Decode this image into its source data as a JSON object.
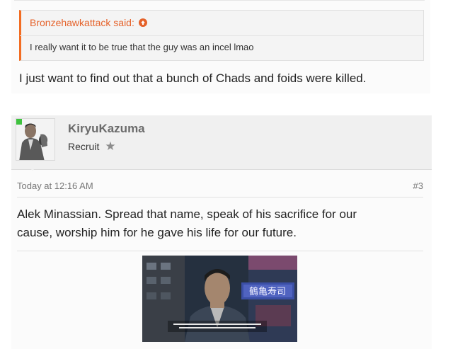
{
  "previous_post": {
    "quote": {
      "author_said": "Bronzehawkattack said:",
      "text": "I really want it to be true that the guy was an incel lmao"
    },
    "body": "I just want to find out that a bunch of Chads and foids were killed."
  },
  "post": {
    "user": {
      "name": "KiryuKazuma",
      "title": "Recruit"
    },
    "timestamp": "Today at 12:16 AM",
    "number": "#3",
    "body_line1": "Alek Minassian. Spread that name, speak of his sacrifice for our",
    "body_line2": "cause, worship him for he gave his life for our future."
  },
  "colors": {
    "accent": "#e5622a",
    "online_badge": "#3ec23e"
  },
  "icons": [
    "arrow-up-icon",
    "star-icon"
  ]
}
